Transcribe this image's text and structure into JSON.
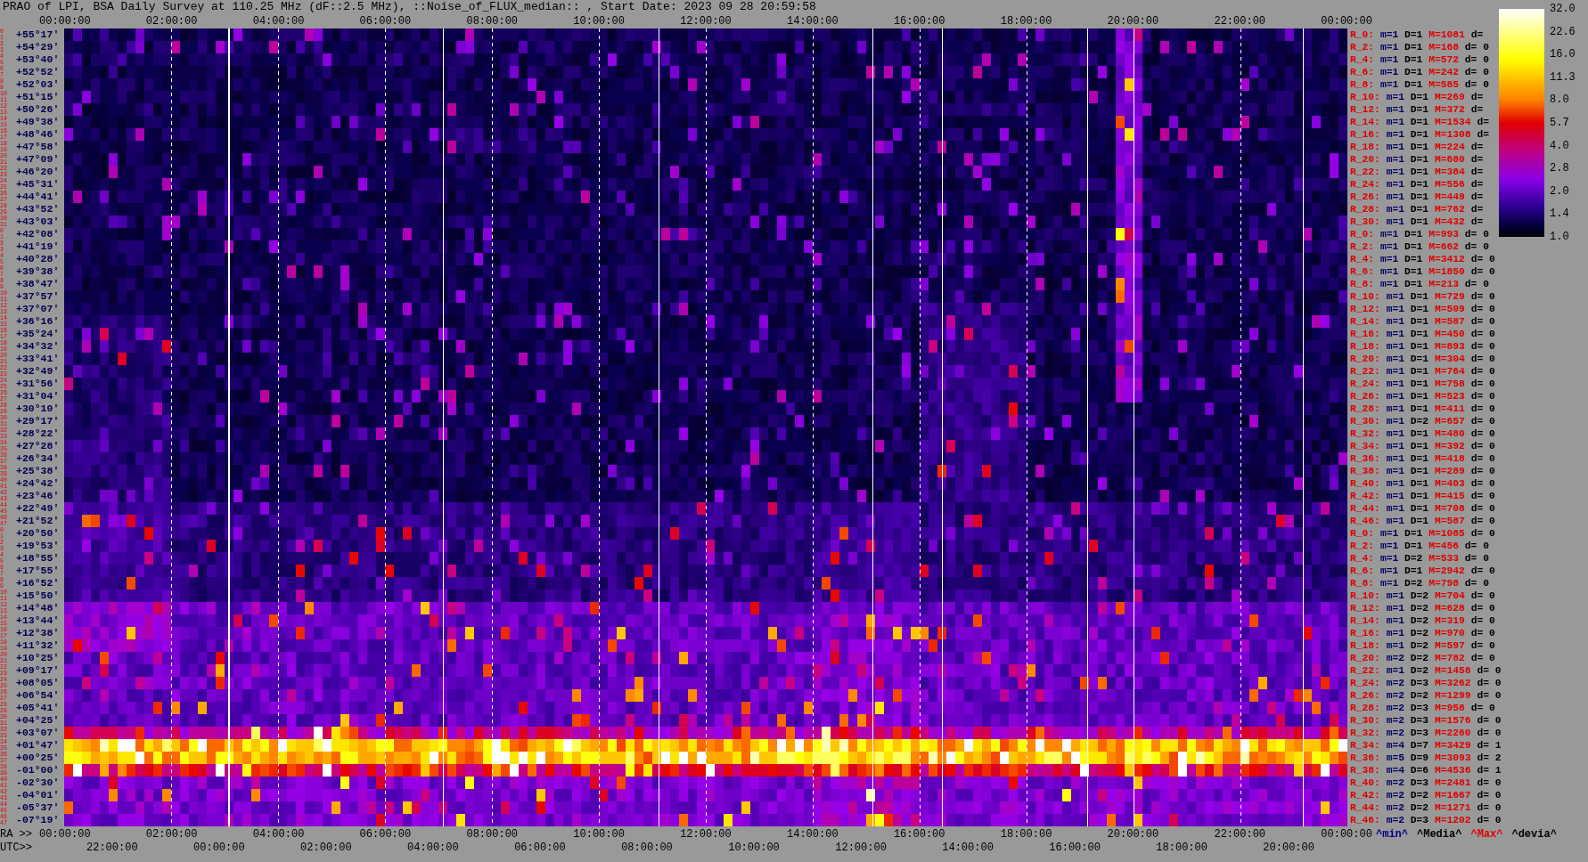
{
  "title": "PRAO of LPI, BSA Daily Survey at 110.25 MHz (dF::2.5 MHz), ::Noise_of_FLUX_median:: , Start Date: 2023 09 28 20:59:58",
  "top_axis": {
    "labels": [
      "00:00:00",
      "02:00:00",
      "04:00:00",
      "06:00:00",
      "08:00:00",
      "10:00:00",
      "12:00:00",
      "14:00:00",
      "16:00:00",
      "18:00:00",
      "20:00:00",
      "22:00:00",
      "00:00:00"
    ]
  },
  "rows": [
    {
      "marks": [
        "0",
        "1"
      ],
      "dec": "+55°17′",
      "stats": {
        "label": "R_0:",
        "m": "m=1",
        "D": "D=1",
        "M": "M=1081",
        "d": "d="
      }
    },
    {
      "marks": [
        "2",
        "3"
      ],
      "dec": "+54°29′",
      "stats": {
        "label": "R_2:",
        "m": "m=1",
        "D": "D=1",
        "M": "M=168",
        "d": "d= 0"
      }
    },
    {
      "marks": [
        "4",
        "5"
      ],
      "dec": "+53°40′",
      "stats": {
        "label": "R_4:",
        "m": "m=1",
        "D": "D=1",
        "M": "M=572",
        "d": "d= 0"
      }
    },
    {
      "marks": [
        "6",
        "7"
      ],
      "dec": "+52°52′",
      "stats": {
        "label": "R_6:",
        "m": "m=1",
        "D": "D=1",
        "M": "M=242",
        "d": "d= 0"
      }
    },
    {
      "marks": [
        "8",
        "9"
      ],
      "dec": "+52°03′",
      "stats": {
        "label": "R_8:",
        "m": "m=1",
        "D": "D=1",
        "M": "M=585",
        "d": "d= 0"
      }
    },
    {
      "marks": [
        "10",
        "11"
      ],
      "dec": "+51°15′",
      "stats": {
        "label": "R_10:",
        "m": "m=1",
        "D": "D=1",
        "M": "M=269",
        "d": "d="
      }
    },
    {
      "marks": [
        "12",
        "13"
      ],
      "dec": "+50°26′",
      "stats": {
        "label": "R_12:",
        "m": "m=1",
        "D": "D=1",
        "M": "M=372",
        "d": "d="
      }
    },
    {
      "marks": [
        "14",
        "15"
      ],
      "dec": "+49°38′",
      "stats": {
        "label": "R_14:",
        "m": "m=1",
        "D": "D=1",
        "M": "M=1534",
        "d": "d="
      }
    },
    {
      "marks": [
        "16",
        "17"
      ],
      "dec": "+48°46′",
      "stats": {
        "label": "R_16:",
        "m": "m=1",
        "D": "D=1",
        "M": "M=1308",
        "d": "d="
      }
    },
    {
      "marks": [
        "18",
        "19"
      ],
      "dec": "+47°58′",
      "stats": {
        "label": "R_18:",
        "m": "m=1",
        "D": "D=1",
        "M": "M=224",
        "d": "d="
      }
    },
    {
      "marks": [
        "20",
        "21"
      ],
      "dec": "+47°09′",
      "stats": {
        "label": "R_20:",
        "m": "m=1",
        "D": "D=1",
        "M": "M=680",
        "d": "d="
      }
    },
    {
      "marks": [
        "22",
        "23"
      ],
      "dec": "+46°20′",
      "stats": {
        "label": "R_22:",
        "m": "m=1",
        "D": "D=1",
        "M": "M=384",
        "d": "d="
      }
    },
    {
      "marks": [
        "24",
        "25"
      ],
      "dec": "+45°31′",
      "stats": {
        "label": "R_24:",
        "m": "m=1",
        "D": "D=1",
        "M": "M=556",
        "d": "d="
      }
    },
    {
      "marks": [
        "26",
        "27"
      ],
      "dec": "+44°41′",
      "stats": {
        "label": "R_26:",
        "m": "m=1",
        "D": "D=1",
        "M": "M=449",
        "d": "d="
      }
    },
    {
      "marks": [
        "28",
        "29"
      ],
      "dec": "+43°52′",
      "stats": {
        "label": "R_28:",
        "m": "m=1",
        "D": "D=1",
        "M": "M=762",
        "d": "d="
      }
    },
    {
      "marks": [
        "30",
        "31"
      ],
      "dec": "+43°03′",
      "stats": {
        "label": "R_30:",
        "m": "m=1",
        "D": "D=1",
        "M": "M=432",
        "d": "d="
      }
    },
    {
      "marks": [
        "0",
        "1"
      ],
      "dec": "+42°08′",
      "stats": {
        "label": "R_0:",
        "m": "m=1",
        "D": "D=1",
        "M": "M=993",
        "d": "d= 0"
      }
    },
    {
      "marks": [
        "2",
        "3"
      ],
      "dec": "+41°19′",
      "stats": {
        "label": "R_2:",
        "m": "m=1",
        "D": "D=1",
        "M": "M=662",
        "d": "d= 0"
      }
    },
    {
      "marks": [
        "4",
        "5"
      ],
      "dec": "+40°28′",
      "stats": {
        "label": "R_4:",
        "m": "m=1",
        "D": "D=1",
        "M": "M=3412",
        "d": "d= 0"
      }
    },
    {
      "marks": [
        "6",
        "7"
      ],
      "dec": "+39°38′",
      "stats": {
        "label": "R_6:",
        "m": "m=1",
        "D": "D=1",
        "M": "M=1850",
        "d": "d= 0"
      }
    },
    {
      "marks": [
        "8",
        "9"
      ],
      "dec": "+38°47′",
      "stats": {
        "label": "R_8:",
        "m": "m=1",
        "D": "D=1",
        "M": "M=213",
        "d": "d= 0"
      }
    },
    {
      "marks": [
        "10",
        "11"
      ],
      "dec": "+37°57′",
      "stats": {
        "label": "R_10:",
        "m": "m=1",
        "D": "D=1",
        "M": "M=729",
        "d": "d= 0"
      }
    },
    {
      "marks": [
        "12",
        "13"
      ],
      "dec": "+37°07′",
      "stats": {
        "label": "R_12:",
        "m": "m=1",
        "D": "D=1",
        "M": "M=509",
        "d": "d= 0"
      }
    },
    {
      "marks": [
        "14",
        "15"
      ],
      "dec": "+36°16′",
      "stats": {
        "label": "R_14:",
        "m": "m=1",
        "D": "D=1",
        "M": "M=587",
        "d": "d= 0"
      }
    },
    {
      "marks": [
        "16",
        "17"
      ],
      "dec": "+35°24′",
      "stats": {
        "label": "R_16:",
        "m": "m=1",
        "D": "D=1",
        "M": "M=450",
        "d": "d= 0"
      }
    },
    {
      "marks": [
        "18",
        "19"
      ],
      "dec": "+34°32′",
      "stats": {
        "label": "R_18:",
        "m": "m=1",
        "D": "D=1",
        "M": "M=893",
        "d": "d= 0"
      }
    },
    {
      "marks": [
        "20",
        "21"
      ],
      "dec": "+33°41′",
      "stats": {
        "label": "R_20:",
        "m": "m=1",
        "D": "D=1",
        "M": "M=304",
        "d": "d= 0"
      }
    },
    {
      "marks": [
        "22",
        "23"
      ],
      "dec": "+32°49′",
      "stats": {
        "label": "R_22:",
        "m": "m=1",
        "D": "D=1",
        "M": "M=764",
        "d": "d= 0"
      }
    },
    {
      "marks": [
        "24",
        "25"
      ],
      "dec": "+31°56′",
      "stats": {
        "label": "R_24:",
        "m": "m=1",
        "D": "D=1",
        "M": "M=758",
        "d": "d= 0"
      }
    },
    {
      "marks": [
        "26",
        "27"
      ],
      "dec": "+31°04′",
      "stats": {
        "label": "R_26:",
        "m": "m=1",
        "D": "D=1",
        "M": "M=523",
        "d": "d= 0"
      }
    },
    {
      "marks": [
        "28",
        "29"
      ],
      "dec": "+30°10′",
      "stats": {
        "label": "R_28:",
        "m": "m=1",
        "D": "D=1",
        "M": "M=411",
        "d": "d= 0"
      }
    },
    {
      "marks": [
        "30",
        "31"
      ],
      "dec": "+29°17′",
      "stats": {
        "label": "R_30:",
        "m": "m=1",
        "D": "D=2",
        "M": "M=657",
        "d": "d= 0"
      }
    },
    {
      "marks": [
        "32",
        "33"
      ],
      "dec": "+28°22′",
      "stats": {
        "label": "R_32:",
        "m": "m=1",
        "D": "D=1",
        "M": "M=480",
        "d": "d= 0"
      }
    },
    {
      "marks": [
        "34",
        "35"
      ],
      "dec": "+27°28′",
      "stats": {
        "label": "R_34:",
        "m": "m=1",
        "D": "D=1",
        "M": "M=392",
        "d": "d= 0"
      }
    },
    {
      "marks": [
        "36",
        "37"
      ],
      "dec": "+26°34′",
      "stats": {
        "label": "R_36:",
        "m": "m=1",
        "D": "D=1",
        "M": "M=418",
        "d": "d= 0"
      }
    },
    {
      "marks": [
        "38",
        "39"
      ],
      "dec": "+25°38′",
      "stats": {
        "label": "R_38:",
        "m": "m=1",
        "D": "D=1",
        "M": "M=289",
        "d": "d= 0"
      }
    },
    {
      "marks": [
        "40",
        "41"
      ],
      "dec": "+24°42′",
      "stats": {
        "label": "R_40:",
        "m": "m=1",
        "D": "D=1",
        "M": "M=403",
        "d": "d= 0"
      }
    },
    {
      "marks": [
        "42",
        "43"
      ],
      "dec": "+23°46′",
      "stats": {
        "label": "R_42:",
        "m": "m=1",
        "D": "D=1",
        "M": "M=415",
        "d": "d= 0"
      }
    },
    {
      "marks": [
        "44",
        "45"
      ],
      "dec": "+22°49′",
      "stats": {
        "label": "R_44:",
        "m": "m=1",
        "D": "D=1",
        "M": "M=708",
        "d": "d= 0"
      }
    },
    {
      "marks": [
        "46",
        "47"
      ],
      "dec": "+21°52′",
      "stats": {
        "label": "R_46:",
        "m": "m=1",
        "D": "D=1",
        "M": "M=587",
        "d": "d= 0"
      }
    },
    {
      "marks": [
        "0",
        "1"
      ],
      "dec": "+20°50′",
      "stats": {
        "label": "R_0:",
        "m": "m=1",
        "D": "D=1",
        "M": "M=1085",
        "d": "d= 0"
      }
    },
    {
      "marks": [
        "2",
        "3"
      ],
      "dec": "+19°53′",
      "stats": {
        "label": "R_2:",
        "m": "m=1",
        "D": "D=1",
        "M": "M=456",
        "d": "d= 0"
      }
    },
    {
      "marks": [
        "4",
        "5"
      ],
      "dec": "+18°55′",
      "stats": {
        "label": "R_4:",
        "m": "m=1",
        "D": "D=2",
        "M": "M=533",
        "d": "d= 0"
      }
    },
    {
      "marks": [
        "6",
        "7"
      ],
      "dec": "+17°55′",
      "stats": {
        "label": "R_6:",
        "m": "m=1",
        "D": "D=1",
        "M": "M=2942",
        "d": "d= 0"
      }
    },
    {
      "marks": [
        "8",
        "9"
      ],
      "dec": "+16°52′",
      "stats": {
        "label": "R_8:",
        "m": "m=1",
        "D": "D=2",
        "M": "M=798",
        "d": "d= 0"
      }
    },
    {
      "marks": [
        "10",
        "11"
      ],
      "dec": "+15°50′",
      "stats": {
        "label": "R_10:",
        "m": "m=1",
        "D": "D=2",
        "M": "M=704",
        "d": "d= 0"
      }
    },
    {
      "marks": [
        "12",
        "13"
      ],
      "dec": "+14°48′",
      "stats": {
        "label": "R_12:",
        "m": "m=1",
        "D": "D=2",
        "M": "M=628",
        "d": "d= 0"
      }
    },
    {
      "marks": [
        "14",
        "15"
      ],
      "dec": "+13°44′",
      "stats": {
        "label": "R_14:",
        "m": "m=1",
        "D": "D=2",
        "M": "M=319",
        "d": "d= 0"
      }
    },
    {
      "marks": [
        "16",
        "17"
      ],
      "dec": "+12°38′",
      "stats": {
        "label": "R_16:",
        "m": "m=1",
        "D": "D=2",
        "M": "M=970",
        "d": "d= 0"
      }
    },
    {
      "marks": [
        "18",
        "19"
      ],
      "dec": "+11°32′",
      "stats": {
        "label": "R_18:",
        "m": "m=1",
        "D": "D=2",
        "M": "M=597",
        "d": "d= 0"
      }
    },
    {
      "marks": [
        "20",
        "21"
      ],
      "dec": "+10°25′",
      "stats": {
        "label": "R_20:",
        "m": "m=2",
        "D": "D=2",
        "M": "M=782",
        "d": "d= 0"
      }
    },
    {
      "marks": [
        "22",
        "23"
      ],
      "dec": "+09°17′",
      "stats": {
        "label": "R_22:",
        "m": "m=1",
        "D": "D=2",
        "M": "M=1458",
        "d": "d= 0"
      }
    },
    {
      "marks": [
        "24",
        "25"
      ],
      "dec": "+08°05′",
      "stats": {
        "label": "R_24:",
        "m": "m=2",
        "D": "D=3",
        "M": "M=3262",
        "d": "d= 0"
      }
    },
    {
      "marks": [
        "26",
        "27"
      ],
      "dec": "+06°54′",
      "stats": {
        "label": "R_26:",
        "m": "m=2",
        "D": "D=2",
        "M": "M=1299",
        "d": "d= 0"
      }
    },
    {
      "marks": [
        "28",
        "29"
      ],
      "dec": "+05°41′",
      "stats": {
        "label": "R_28:",
        "m": "m=2",
        "D": "D=3",
        "M": "M=958",
        "d": "d= 0"
      }
    },
    {
      "marks": [
        "30",
        "31"
      ],
      "dec": "+04°25′",
      "stats": {
        "label": "R_30:",
        "m": "m=2",
        "D": "D=3",
        "M": "M=1576",
        "d": "d= 0"
      }
    },
    {
      "marks": [
        "32",
        "33"
      ],
      "dec": "+03°07′",
      "stats": {
        "label": "R_32:",
        "m": "m=2",
        "D": "D=3",
        "M": "M=2260",
        "d": "d= 0"
      }
    },
    {
      "marks": [
        "34",
        "35"
      ],
      "dec": "+01°47′",
      "stats": {
        "label": "R_34:",
        "m": "m=4",
        "D": "D=7",
        "M": "M=3429",
        "d": "d= 1"
      }
    },
    {
      "marks": [
        "36",
        "37"
      ],
      "dec": "+00°25′",
      "stats": {
        "label": "R_36:",
        "m": "m=5",
        "D": "D=9",
        "M": "M=3093",
        "d": "d= 2"
      }
    },
    {
      "marks": [
        "38",
        "39"
      ],
      "dec": "-01°00′",
      "stats": {
        "label": "R_38:",
        "m": "m=4",
        "D": "D=6",
        "M": "M=4536",
        "d": "d= 1"
      }
    },
    {
      "marks": [
        "40",
        "41"
      ],
      "dec": "-02°30′",
      "stats": {
        "label": "R_40:",
        "m": "m=2",
        "D": "D=3",
        "M": "M=2481",
        "d": "d= 0"
      }
    },
    {
      "marks": [
        "42",
        "43"
      ],
      "dec": "-04°01′",
      "stats": {
        "label": "R_42:",
        "m": "m=2",
        "D": "D=2",
        "M": "M=1667",
        "d": "d= 0"
      }
    },
    {
      "marks": [
        "44",
        "45"
      ],
      "dec": "-05°37′",
      "stats": {
        "label": "R_44:",
        "m": "m=2",
        "D": "D=2",
        "M": "M=1271",
        "d": "d= 0"
      }
    },
    {
      "marks": [
        "46",
        "47"
      ],
      "dec": "-07°19′",
      "stats": {
        "label": "R_46:",
        "m": "m=2",
        "D": "D=3",
        "M": "M=1202",
        "d": "d= 0"
      }
    }
  ],
  "bottom_axis": {
    "ra_prefix": "RA >>",
    "ra_labels": [
      "00:00:00",
      "02:00:00",
      "04:00:00",
      "06:00:00",
      "08:00:00",
      "10:00:00",
      "12:00:00",
      "14:00:00",
      "16:00:00",
      "18:00:00",
      "20:00:00",
      "22:00:00",
      "00:00:00"
    ],
    "utc_prefix": "UTC>>",
    "utc_labels": [
      "22:00:00",
      "00:00:00",
      "02:00:00",
      "04:00:00",
      "06:00:00",
      "08:00:00",
      "10:00:00",
      "12:00:00",
      "14:00:00",
      "16:00:00",
      "18:00:00",
      "20:00:00"
    ]
  },
  "legend": [
    {
      "kind": "min",
      "text": "^min^"
    },
    {
      "kind": "median",
      "text": "^Media^"
    },
    {
      "kind": "max",
      "text": "^Max^"
    },
    {
      "kind": "deviation",
      "text": "^devia^"
    }
  ],
  "colorbar": {
    "labels": [
      "32.0",
      "22.6",
      "16.0",
      "11.3",
      "8.0",
      "5.7",
      "4.0",
      "2.8",
      "2.0",
      "1.4",
      "1.0"
    ]
  }
}
